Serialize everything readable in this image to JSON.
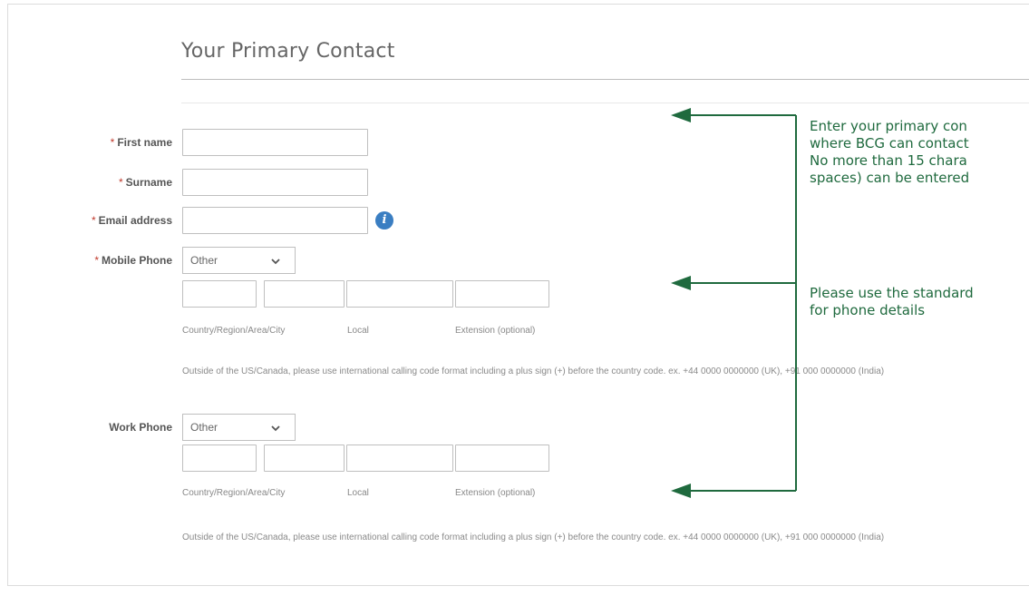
{
  "section": {
    "title": "Your Primary Contact"
  },
  "fields": {
    "first_name": {
      "label": "First name",
      "required": "*",
      "value": ""
    },
    "surname": {
      "label": "Surname",
      "required": "*",
      "value": ""
    },
    "email": {
      "label": "Email address",
      "required": "*",
      "value": "",
      "info_icon": "i"
    },
    "mobile": {
      "label": "Mobile Phone",
      "required": "*",
      "type_value": "Other",
      "sub_labels": [
        "Country/Region/Area/City",
        "Local",
        "Extension (optional)"
      ],
      "hint": "Outside of the US/Canada, please use international calling code format including a plus sign (+) before the country code. ex. +44 0000 0000000 (UK), +91 000 0000000 (India)"
    },
    "work": {
      "label": "Work Phone",
      "type_value": "Other",
      "sub_labels": [
        "Country/Region/Area/City",
        "Local",
        "Extension (optional)"
      ],
      "hint": "Outside of the US/Canada, please use international calling code format including a plus sign (+) before the country code. ex. +44 0000 0000000 (UK), +91 000 0000000 (India)"
    }
  },
  "annotations": {
    "note1": [
      "Enter your primary con",
      "where BCG can contact",
      "No more than 15 chara",
      "spaces) can be entered"
    ],
    "note2": [
      "Please use the standard",
      "for phone details"
    ],
    "color": "#1f6a3e"
  }
}
